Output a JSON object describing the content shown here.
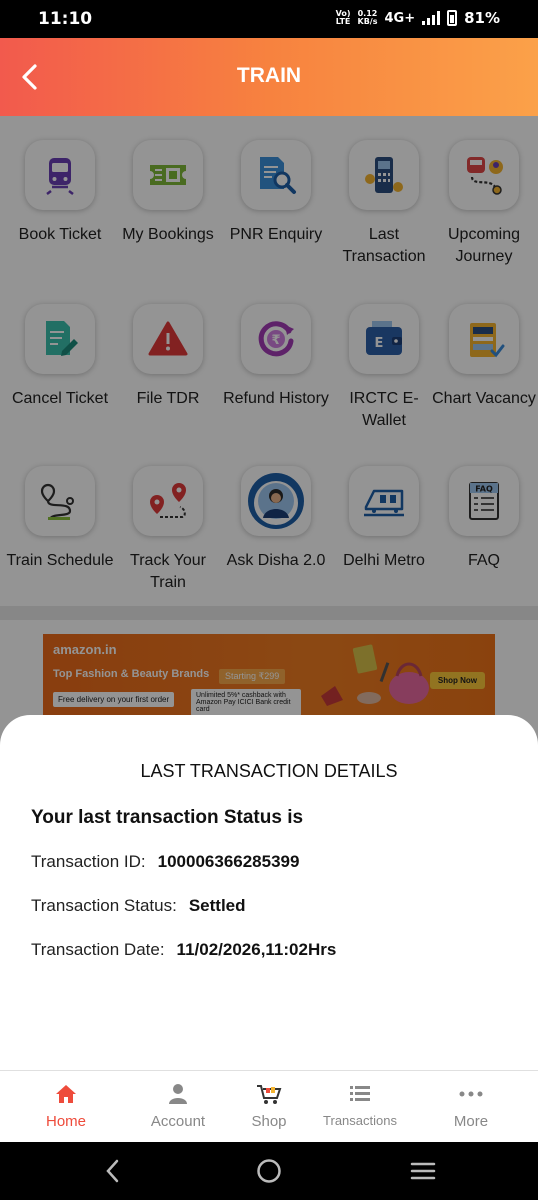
{
  "status_bar": {
    "time": "11:10",
    "volte_top": "Vo)",
    "volte_bottom": "LTE",
    "speed_top": "0.12",
    "speed_bottom": "KB/s",
    "network": "4G+",
    "battery": "81%"
  },
  "header": {
    "title": "TRAIN"
  },
  "services": [
    {
      "label": "Book Ticket",
      "icon": "train-icon"
    },
    {
      "label": "My Bookings",
      "icon": "ticket-icon"
    },
    {
      "label": "PNR Enquiry",
      "icon": "document-search-icon"
    },
    {
      "label": "Last Transaction",
      "icon": "pos-terminal-icon"
    },
    {
      "label": "Upcoming Journey",
      "icon": "journey-route-icon"
    },
    {
      "label": "Cancel Ticket",
      "icon": "edit-document-icon"
    },
    {
      "label": "File TDR",
      "icon": "warning-icon"
    },
    {
      "label": "Refund History",
      "icon": "refund-rupee-icon"
    },
    {
      "label": "IRCTC E-Wallet",
      "icon": "wallet-icon"
    },
    {
      "label": "Chart Vacancy",
      "icon": "chart-clipboard-icon"
    },
    {
      "label": "Train Schedule",
      "icon": "route-pins-icon"
    },
    {
      "label": "Track Your Train",
      "icon": "map-pins-icon"
    },
    {
      "label": "Ask Disha 2.0",
      "icon": "disha-assistant-icon"
    },
    {
      "label": "Delhi Metro",
      "icon": "metro-train-icon"
    },
    {
      "label": "FAQ",
      "icon": "faq-document-icon"
    }
  ],
  "ad": {
    "brand": "amazon.in",
    "headline": "Top Fashion & Beauty Brands",
    "price": "Starting ₹299",
    "delivery": "Free delivery on your first order",
    "cashback": "Unlimited 5%* cashback with Amazon Pay ICICI Bank credit card",
    "cta": "Shop Now"
  },
  "sheet": {
    "title": "LAST TRANSACTION DETAILS",
    "subtitle": "Your last transaction Status is",
    "rows": [
      {
        "label": "Transaction ID:",
        "value": "100006366285399"
      },
      {
        "label": "Transaction Status:",
        "value": "Settled"
      },
      {
        "label": "Transaction Date:",
        "value": "11/02/2026,11:02Hrs"
      }
    ]
  },
  "bottom_nav": [
    {
      "label": "Home",
      "icon": "home-icon",
      "active": true
    },
    {
      "label": "Account",
      "icon": "person-icon",
      "active": false
    },
    {
      "label": "Shop",
      "icon": "cart-icon",
      "active": false
    },
    {
      "label": "Transactions",
      "icon": "list-icon",
      "active": false
    },
    {
      "label": "More",
      "icon": "more-dots-icon",
      "active": false
    }
  ],
  "colors": {
    "header_start": "#f25a4d",
    "header_end": "#fba149",
    "active_nav": "#ee4b3b"
  }
}
